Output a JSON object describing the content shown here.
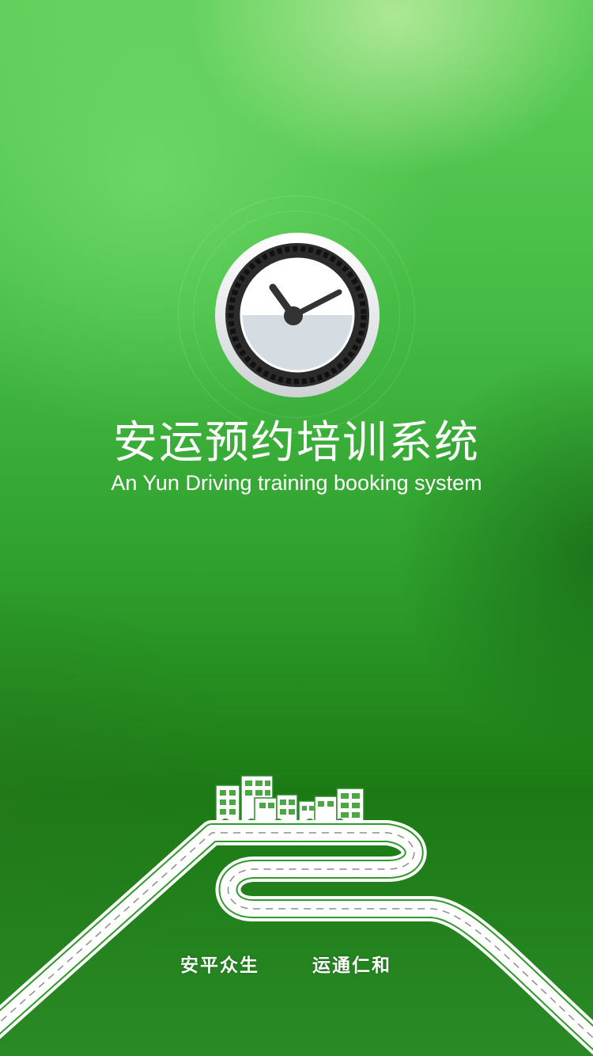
{
  "splash": {
    "title": "安运预约培训系统",
    "subtitle": "An Yun Driving training booking system",
    "slogan_left": "安平众生",
    "slogan_right": "运通仁和"
  },
  "icons": {
    "logo": "clock-tire-icon",
    "illustration": "city-road-icon"
  },
  "colors": {
    "background_top": "#5fcf5a",
    "background_bottom": "#1c7a14",
    "text": "#ffffff",
    "tire": "#2b2b2b",
    "clock_face_top": "#ffffff",
    "clock_face_bottom": "#d6dde2"
  }
}
